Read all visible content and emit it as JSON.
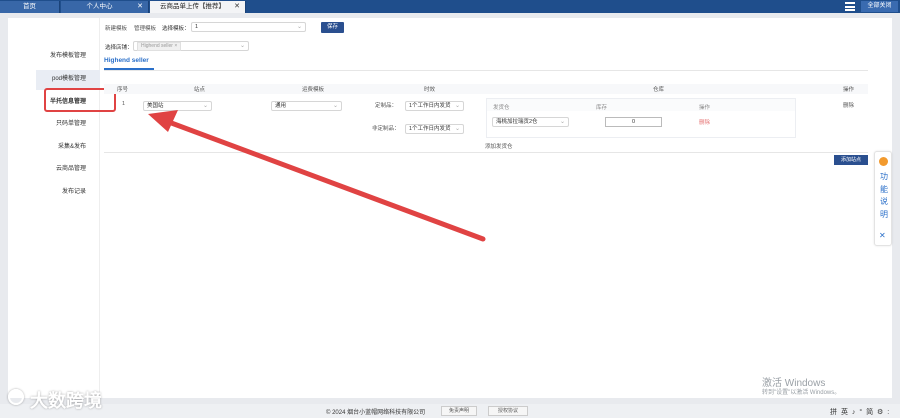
{
  "tabs": [
    {
      "label": "首页",
      "closable": false
    },
    {
      "label": "个人中心",
      "closable": true
    },
    {
      "label": "云商品单上传【推荐】",
      "closable": true,
      "active": true
    }
  ],
  "topbar": {
    "close_all_label": "全部关闭"
  },
  "sidebar": {
    "items": [
      "发布模板管理",
      "pod模板管理",
      "半托信息管理",
      "只码单管理",
      "采集&发布",
      "云商品管理",
      "发布记录"
    ],
    "active_index": 2
  },
  "toolbar": {
    "new_template_link": "新建模板",
    "manage_template_link": "管理模板",
    "select_template_label": "选择模板：",
    "template_value": "1",
    "save_label": "保存"
  },
  "store": {
    "select_label": "选择店铺：",
    "store_tag": "Highend seller",
    "tab_label": "Highend seller"
  },
  "table": {
    "headers": {
      "index": "序号",
      "site": "站点",
      "shipping_template": "运费模板",
      "timeliness": "时效",
      "warehouse": "仓库",
      "action": "操作"
    },
    "row": {
      "index": "1",
      "site": "美国站",
      "shipping": "通用",
      "custom_label": "定制品：",
      "custom_value": "1个工作日内发货",
      "noncustom_label": "非定制品：",
      "noncustom_value": "1个工作日内发货",
      "delete_label": "删除"
    },
    "warehouse": {
      "col_shipping": "发货仓",
      "col_stock": "库存",
      "col_action": "操作",
      "warehouse_value": "海桃加拉瑞贡2仓",
      "stock_value": "0",
      "delete_label": "删除"
    },
    "add_warehouse_link": "添加发货仓",
    "add_site_button": "添加站点"
  },
  "widget": {
    "text": [
      "功",
      "能",
      "说",
      "明"
    ],
    "close": "✕"
  },
  "footer": {
    "copyright": "© 2024 烟台小蓝帽网络科技有限公司",
    "disclaimer_label": "免责声明",
    "license_label": "授权协议"
  },
  "os": {
    "activate_title": "激活 Windows",
    "activate_sub": "转到\"设置\"以激活 Windows。",
    "ime": "拼 英 ♪ ° 简 ⚙ :"
  },
  "watermark": "大数跨境",
  "colors": {
    "brand_blue": "#1f4e8c",
    "accent_link": "#2a6fc9",
    "annotation_red": "#e04343",
    "button_dark": "#2a4f8f"
  }
}
